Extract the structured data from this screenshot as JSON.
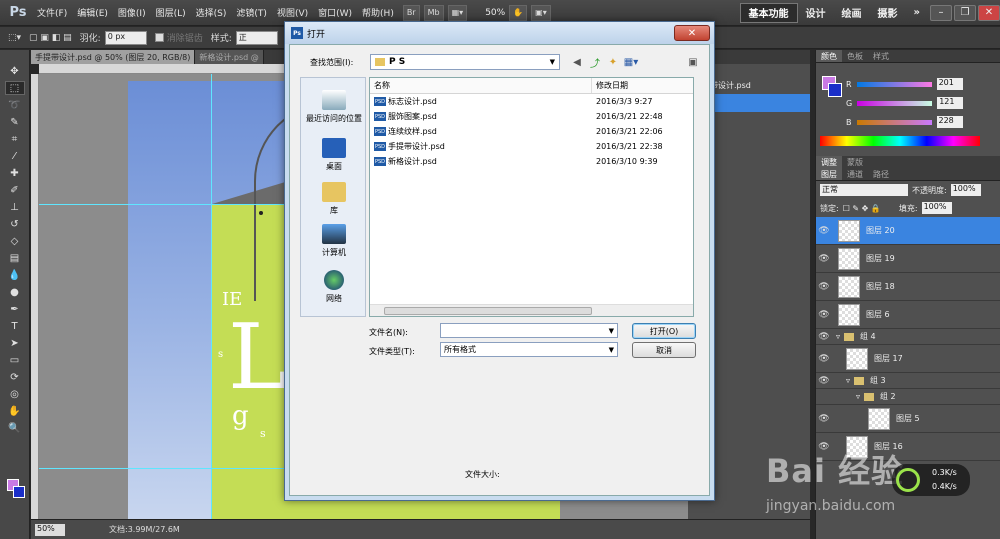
{
  "menubar": {
    "logo": "Ps",
    "items": [
      "文件(F)",
      "编辑(E)",
      "图像(I)",
      "图层(L)",
      "选择(S)",
      "滤镜(T)",
      "视图(V)",
      "窗口(W)",
      "帮助(H)"
    ],
    "btn_br": "Br",
    "btn_mb": "Mb",
    "zoom": "50%",
    "workspaces": [
      "基本功能",
      "设计",
      "绘画",
      "摄影"
    ]
  },
  "options": {
    "feather_label": "羽化:",
    "feather_value": "0 px",
    "antialias_label": "消除锯齿",
    "style_label": "样式:",
    "style_value": "正"
  },
  "doc": {
    "tabs": [
      "手提带设计.psd @ 50% (图层 20, RGB/8)",
      "新格设计.psd @"
    ],
    "zoom_field": "50%",
    "size": "文档:3.99M/27.6M",
    "letters": [
      "IE",
      "s",
      "L",
      "g",
      "s"
    ]
  },
  "history": {
    "items": [
      "手提带设计.psd",
      ""
    ]
  },
  "color_panel": {
    "tabs": [
      "颜色",
      "色板",
      "样式"
    ],
    "r_label": "R",
    "g_label": "G",
    "b_label": "B",
    "r": "201",
    "g": "121",
    "b": "228"
  },
  "adjust_tabs": [
    "调整",
    "蒙版"
  ],
  "layers_panel": {
    "tabs": [
      "图层",
      "通道",
      "路径"
    ],
    "blend_mode": "正常",
    "opacity_label": "不透明度:",
    "opacity": "100%",
    "lock_label": "锁定:",
    "fill_label": "填充:",
    "fill": "100%",
    "layers": [
      {
        "name": "图层 20",
        "active": true
      },
      {
        "name": "图层 19"
      },
      {
        "name": "图层 18"
      },
      {
        "name": "图层 6"
      },
      {
        "name": "组 4",
        "group": true
      },
      {
        "name": "图层 17"
      },
      {
        "name": "组 3",
        "group": true
      },
      {
        "name": "组 2",
        "group": true
      },
      {
        "name": "图层 5"
      },
      {
        "name": "图层 16"
      }
    ]
  },
  "dialog": {
    "title": "打开",
    "lookin_label": "查找范围(I):",
    "lookin_value": "P S",
    "places": [
      "最近访问的位置",
      "桌面",
      "库",
      "计算机",
      "网络"
    ],
    "col_name": "名称",
    "col_date": "修改日期",
    "files": [
      {
        "name": "标志设计.psd",
        "date": "2016/3/3 9:27"
      },
      {
        "name": "服饰图案.psd",
        "date": "2016/3/21 22:48"
      },
      {
        "name": "连续纹样.psd",
        "date": "2016/3/21 22:06"
      },
      {
        "name": "手提带设计.psd",
        "date": "2016/3/21 22:38"
      },
      {
        "name": "新格设计.psd",
        "date": "2016/3/10 9:39"
      }
    ],
    "filename_label": "文件名(N):",
    "filename_value": "",
    "filetype_label": "文件类型(T):",
    "filetype_value": "所有格式",
    "open_btn": "打开(O)",
    "cancel_btn": "取消",
    "filesize_label": "文件大小:"
  },
  "watermark": {
    "main": "Bai 经验",
    "sub": "jingyan.baidu.com"
  },
  "net_widget": {
    "up": "0.3K/s",
    "down": "0.4K/s"
  },
  "colors": {
    "foreground": "#c97ae4",
    "background": "#1a2ec8",
    "bag": "#c4dd55",
    "selection": "#3a84e0"
  }
}
